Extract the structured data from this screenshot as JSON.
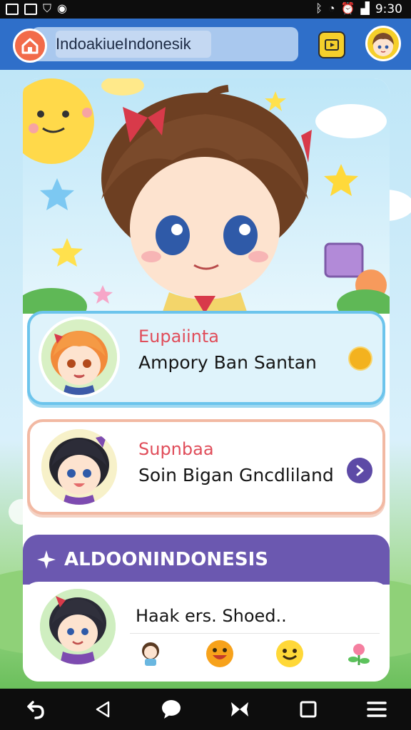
{
  "status_bar": {
    "time": "9:30",
    "icons": [
      "gallery-icon",
      "image-icon",
      "shield-icon",
      "record-icon",
      "bluetooth-icon",
      "wifi-icon",
      "alarm-icon",
      "signal-icon"
    ]
  },
  "app_bar": {
    "url_text": "IndoakiueIndonesik",
    "home_icon": "home-icon",
    "video_icon": "video-icon",
    "avatar_icon": "profile-avatar"
  },
  "cards": [
    {
      "title": "Eupaiinta",
      "subtitle": "Ampory Ban Santan",
      "action_icon": "yellow-dot-icon",
      "colors": {
        "title": "#e04d5a",
        "accent": "#6cc4ec"
      }
    },
    {
      "title": "Supnbaa",
      "subtitle": "Soin Bigan Gncdliland",
      "action_icon": "play-arrow-icon",
      "colors": {
        "title": "#e04d5a",
        "accent": "#f2b9a3"
      }
    }
  ],
  "section": {
    "label": "ALDOONINDONESIS",
    "icon": "sparkle-icon",
    "color": "#6b58b0"
  },
  "chat": {
    "text": "Haak ers. Shoed..",
    "emojis": [
      "kid-sticker-icon",
      "smile-face-icon",
      "happy-face-icon",
      "flower-icon"
    ]
  },
  "nav_bar": {
    "buttons": [
      "back-icon",
      "nav-back-triangle-icon",
      "chat-bubble-icon",
      "butterfly-icon",
      "square-icon",
      "menu-icon"
    ]
  }
}
